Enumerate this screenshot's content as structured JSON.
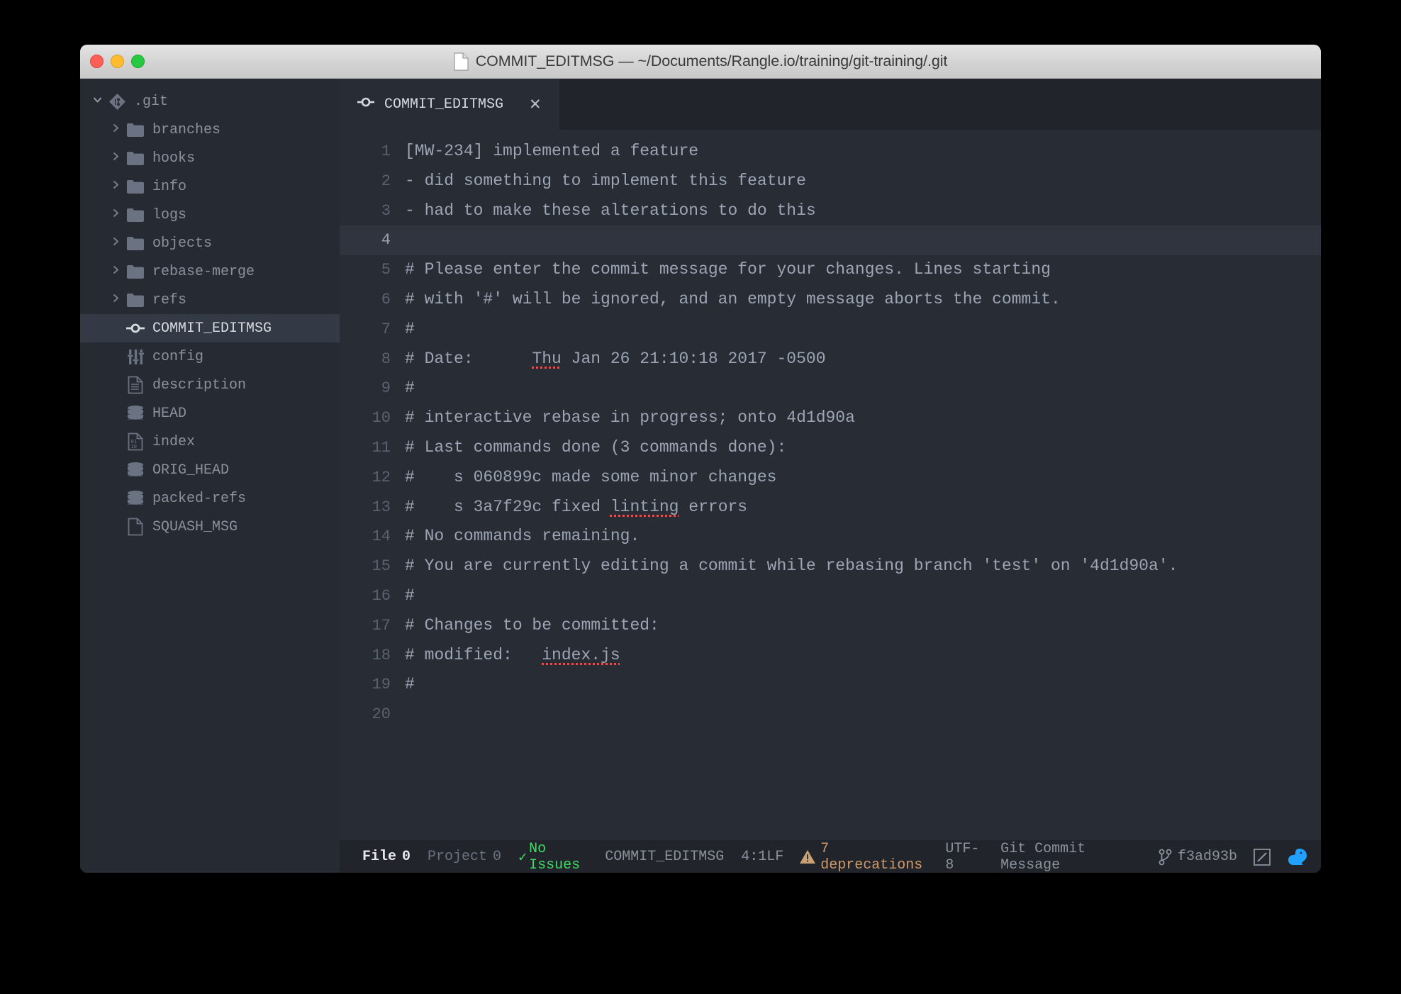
{
  "window": {
    "title": "COMMIT_EDITMSG — ~/Documents/Rangle.io/training/git-training/.git",
    "title_icon": "document-icon",
    "traffic_lights": [
      "close-button",
      "minimize-button",
      "zoom-button"
    ],
    "colors": {
      "titlebar": "#d3d3d3",
      "sidebar_bg": "#262a33",
      "editor_bg": "#282c34",
      "tabbar_bg": "#21252b",
      "statusbar_bg": "#21252b",
      "text": "#9da5b4",
      "selected_row": "#333a45",
      "ok_green": "#3ddc62",
      "warn_orange": "#d19a66",
      "spellcheck_red": "#e05252",
      "squirrel_blue": "#21a0ff"
    }
  },
  "sidebar": {
    "root": {
      "label": ".git",
      "icon": "git-icon",
      "twisty": "chevron-down-icon",
      "expanded": true
    },
    "items": [
      {
        "label": "branches",
        "icon": "folder-icon",
        "twisty": "chevron-right-icon",
        "type": "folder",
        "selected": false
      },
      {
        "label": "hooks",
        "icon": "folder-icon",
        "twisty": "chevron-right-icon",
        "type": "folder",
        "selected": false
      },
      {
        "label": "info",
        "icon": "folder-icon",
        "twisty": "chevron-right-icon",
        "type": "folder",
        "selected": false
      },
      {
        "label": "logs",
        "icon": "folder-icon",
        "twisty": "chevron-right-icon",
        "type": "folder",
        "selected": false
      },
      {
        "label": "objects",
        "icon": "folder-icon",
        "twisty": "chevron-right-icon",
        "type": "folder",
        "selected": false
      },
      {
        "label": "rebase-merge",
        "icon": "folder-icon",
        "twisty": "chevron-right-icon",
        "type": "folder",
        "selected": false
      },
      {
        "label": "refs",
        "icon": "folder-icon",
        "twisty": "chevron-right-icon",
        "type": "folder",
        "selected": false
      },
      {
        "label": "COMMIT_EDITMSG",
        "icon": "git-commit-icon",
        "twisty": "",
        "type": "file",
        "selected": true
      },
      {
        "label": "config",
        "icon": "settings-icon",
        "twisty": "",
        "type": "file",
        "selected": false
      },
      {
        "label": "description",
        "icon": "text-file-icon",
        "twisty": "",
        "type": "file",
        "selected": false
      },
      {
        "label": "HEAD",
        "icon": "database-icon",
        "twisty": "",
        "type": "file",
        "selected": false
      },
      {
        "label": "index",
        "icon": "binary-file-icon",
        "twisty": "",
        "type": "file",
        "selected": false
      },
      {
        "label": "ORIG_HEAD",
        "icon": "database-icon",
        "twisty": "",
        "type": "file",
        "selected": false
      },
      {
        "label": "packed-refs",
        "icon": "database-icon",
        "twisty": "",
        "type": "file",
        "selected": false
      },
      {
        "label": "SQUASH_MSG",
        "icon": "blank-file-icon",
        "twisty": "",
        "type": "file",
        "selected": false
      }
    ]
  },
  "tabs": [
    {
      "label": "COMMIT_EDITMSG",
      "icon": "git-commit-icon",
      "close_icon": "✕",
      "active": true
    }
  ],
  "editor": {
    "cursor": "4:1",
    "active_line": 4,
    "lines": [
      {
        "n": "1",
        "text": "[MW-234] implemented a feature"
      },
      {
        "n": "2",
        "text": "- did something to implement this feature"
      },
      {
        "n": "3",
        "text": "- had to make these alterations to do this"
      },
      {
        "n": "4",
        "text": ""
      },
      {
        "n": "5",
        "text": "# Please enter the commit message for your changes. Lines starting"
      },
      {
        "n": "6",
        "text": "# with '#' will be ignored, and an empty message aborts the commit."
      },
      {
        "n": "7",
        "text": "#"
      },
      {
        "n": "8",
        "text": "# Date:      Thu Jan 26 21:10:18 2017 -0500",
        "spell": "Thu"
      },
      {
        "n": "9",
        "text": "#"
      },
      {
        "n": "10",
        "text": "# interactive rebase in progress; onto 4d1d90a"
      },
      {
        "n": "11",
        "text": "# Last commands done (3 commands done):"
      },
      {
        "n": "12",
        "text": "#    s 060899c made some minor changes"
      },
      {
        "n": "13",
        "text": "#    s 3a7f29c fixed linting errors",
        "spell": "linting"
      },
      {
        "n": "14",
        "text": "# No commands remaining."
      },
      {
        "n": "15",
        "text": "# You are currently editing a commit while rebasing branch 'test' on '4d1d90a'."
      },
      {
        "n": "16",
        "text": "#"
      },
      {
        "n": "17",
        "text": "# Changes to be committed:"
      },
      {
        "n": "18",
        "text": "# modified:   index.js",
        "spell": "index.js"
      },
      {
        "n": "19",
        "text": "#"
      },
      {
        "n": "20",
        "text": ""
      }
    ]
  },
  "statusbar": {
    "file_label": "File",
    "file_count": "0",
    "project_label": "Project",
    "project_count": "0",
    "issues_check": "✓",
    "issues_text": "No Issues",
    "filename": "COMMIT_EDITMSG",
    "cursor": "4:1",
    "line_ending": "LF",
    "deprecations": "7 deprecations",
    "encoding": "UTF-8",
    "grammar": "Git Commit Message",
    "branch": "f3ad93b",
    "branch_icon": "git-branch-icon",
    "edit_icon": "pencil-square-icon",
    "squirrel_icon": "squirrel-icon",
    "warning_icon": "warning-triangle-icon"
  }
}
